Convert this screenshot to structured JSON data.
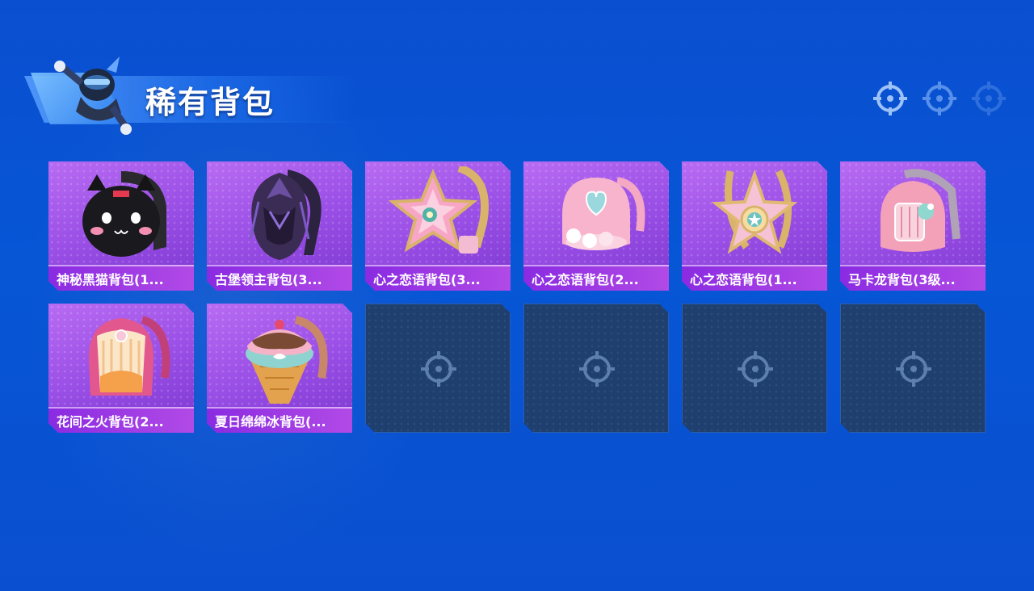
{
  "header": {
    "title": "稀有背包"
  },
  "colors": {
    "background": "#0656d6",
    "card_purple": "#9a4fe6",
    "name_bar": "#8a2be2",
    "empty_slot": "#1f3f6e"
  },
  "items": [
    {
      "name": "神秘黑猫背包(1...",
      "icon": "black-cat-backpack-icon"
    },
    {
      "name": "古堡领主背包(3...",
      "icon": "castle-lord-backpack-icon"
    },
    {
      "name": "心之恋语背包(3...",
      "icon": "star-backpack-icon"
    },
    {
      "name": "心之恋语背包(2...",
      "icon": "pink-heart-backpack-icon"
    },
    {
      "name": "心之恋语背包(1...",
      "icon": "star-backpack-icon"
    },
    {
      "name": "马卡龙背包(3级...",
      "icon": "macaron-backpack-icon"
    },
    {
      "name": "花间之火背包(2...",
      "icon": "flower-fire-backpack-icon"
    },
    {
      "name": "夏日绵绵冰背包(...",
      "icon": "ice-cream-backpack-icon"
    }
  ],
  "empty_slots": 4
}
